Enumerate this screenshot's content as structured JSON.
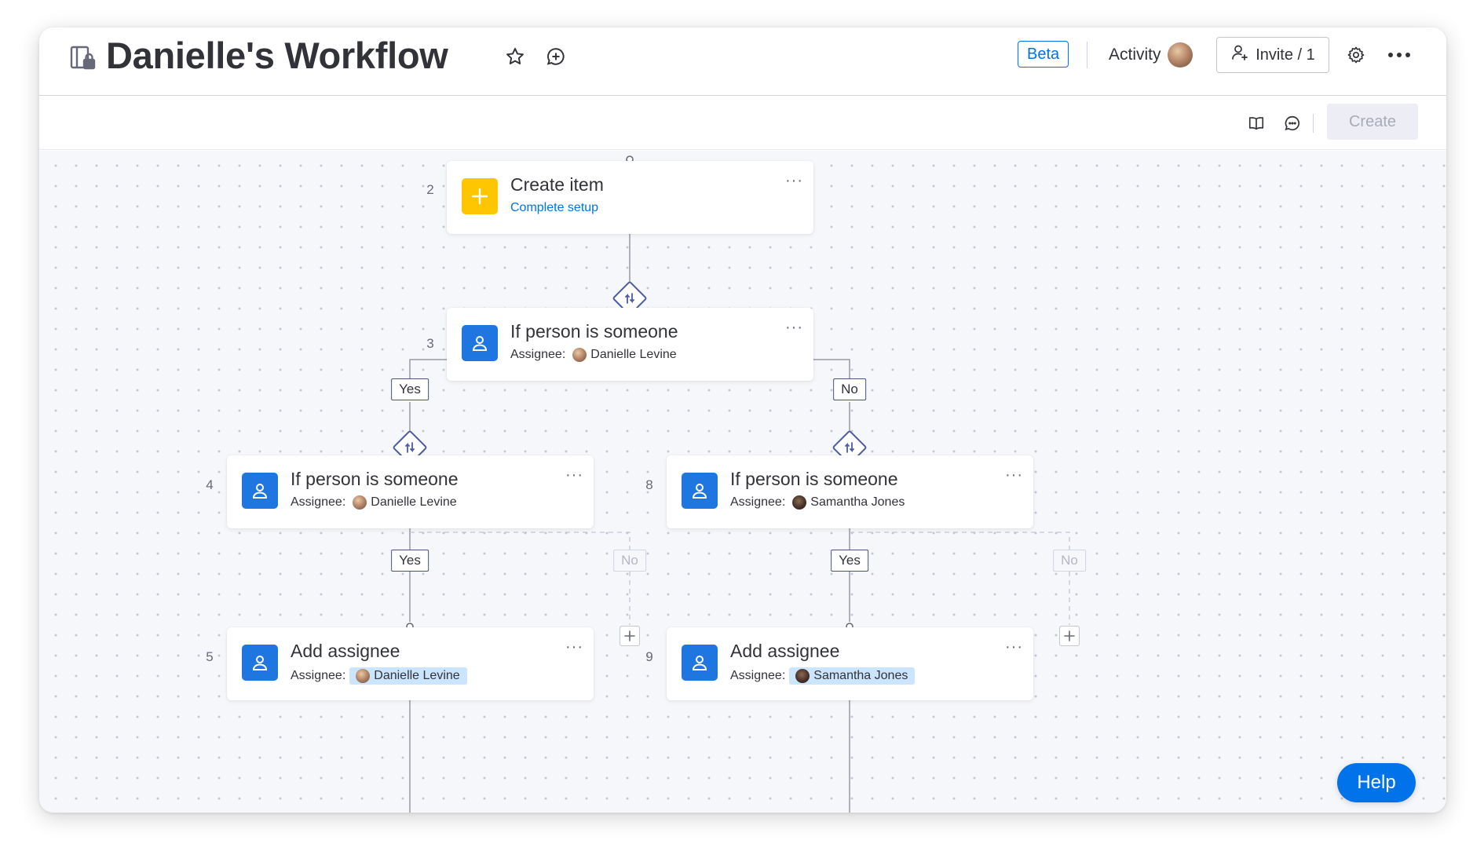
{
  "header": {
    "title": "Danielle's Workflow",
    "beta_label": "Beta",
    "activity_label": "Activity",
    "invite_label": "Invite / 1"
  },
  "toolbar": {
    "create_label": "Create"
  },
  "nodes": [
    {
      "step": "2",
      "title": "Create item",
      "subtitle_link": "Complete setup",
      "icon": "plus-icon",
      "tile_color": "#fdc600"
    },
    {
      "step": "3",
      "title": "If person is someone",
      "assignee_label": "Assignee:",
      "assignee": "Danielle Levine",
      "icon": "person-icon",
      "tile_color": "#1f76e0"
    },
    {
      "step": "4",
      "title": "If person is someone",
      "assignee_label": "Assignee:",
      "assignee": "Danielle Levine",
      "icon": "person-icon",
      "tile_color": "#1f76e0"
    },
    {
      "step": "8",
      "title": "If person is someone",
      "assignee_label": "Assignee:",
      "assignee": "Samantha Jones",
      "icon": "person-icon",
      "tile_color": "#1f76e0"
    },
    {
      "step": "5",
      "title": "Add assignee",
      "assignee_label": "Assignee:",
      "assignee": "Danielle Levine",
      "icon": "person-icon",
      "tile_color": "#1f76e0"
    },
    {
      "step": "9",
      "title": "Add assignee",
      "assignee_label": "Assignee:",
      "assignee": "Samantha Jones",
      "icon": "person-icon",
      "tile_color": "#1f76e0"
    }
  ],
  "branches": {
    "yes_label": "Yes",
    "no_label": "No"
  },
  "help_label": "Help",
  "colors": {
    "accent": "#0073ea",
    "tile_blue": "#1f76e0",
    "tile_yellow": "#fdc600",
    "connector": "#9699a6",
    "diamond": "#4b5aa8"
  }
}
